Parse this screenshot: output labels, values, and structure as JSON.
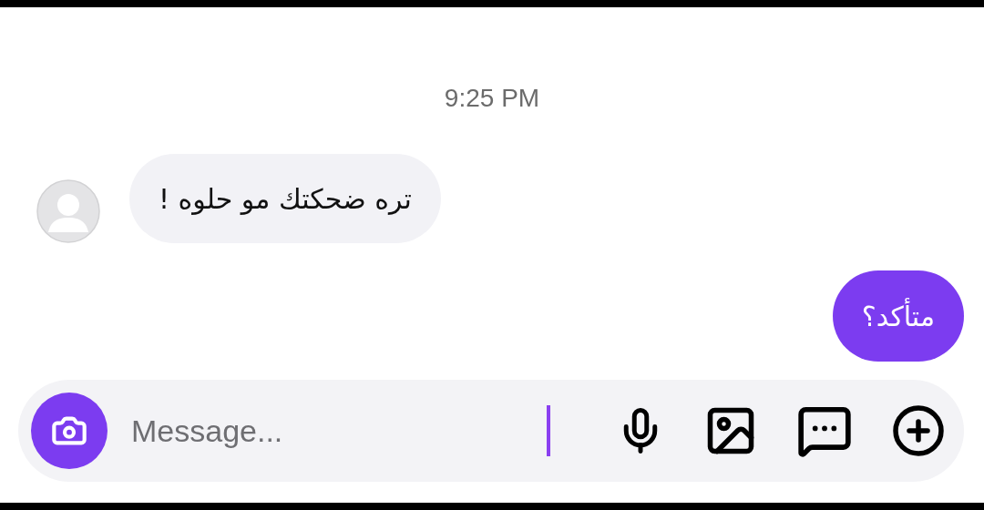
{
  "timestamp": "9:25 PM",
  "messages": [
    {
      "kind": "incoming",
      "text": "تره ضحكتك مو حلوه !"
    },
    {
      "kind": "outgoing",
      "text": "متأكد؟"
    }
  ],
  "composer": {
    "placeholder": "Message..."
  }
}
